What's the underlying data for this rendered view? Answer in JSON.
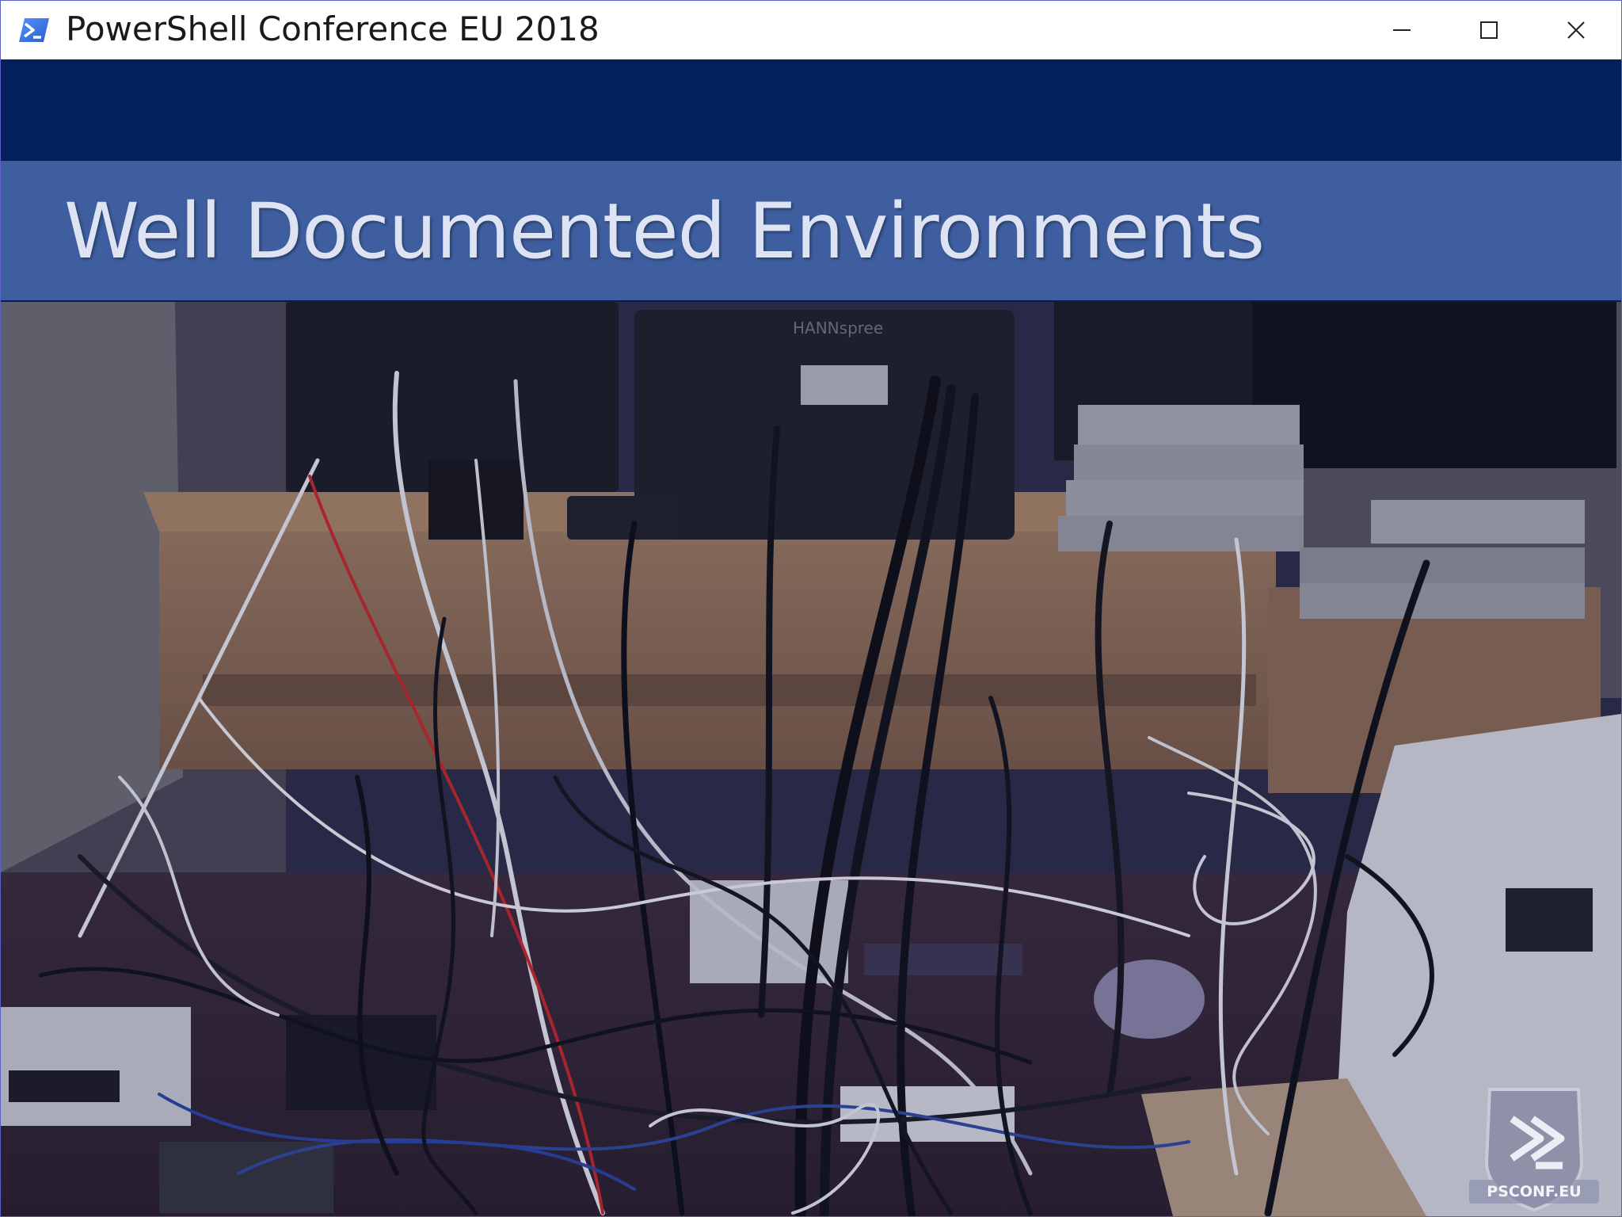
{
  "window": {
    "title": "PowerShell Conference EU 2018",
    "icon": "powershell-icon",
    "controls": {
      "minimize": "minimize-icon",
      "maximize": "maximize-icon",
      "close": "close-icon"
    },
    "border_color": "#5b5fc7"
  },
  "slide": {
    "title": "Well Documented Environments",
    "colors": {
      "top_band": "#03205b",
      "title_band": "#3e5e9f",
      "title_text": "#dde3f3"
    },
    "photo": {
      "subject": "tangle-of-cables-photo"
    },
    "logo": {
      "text": "PSCONF.EU",
      "icon": "psconf-shield-icon"
    }
  }
}
